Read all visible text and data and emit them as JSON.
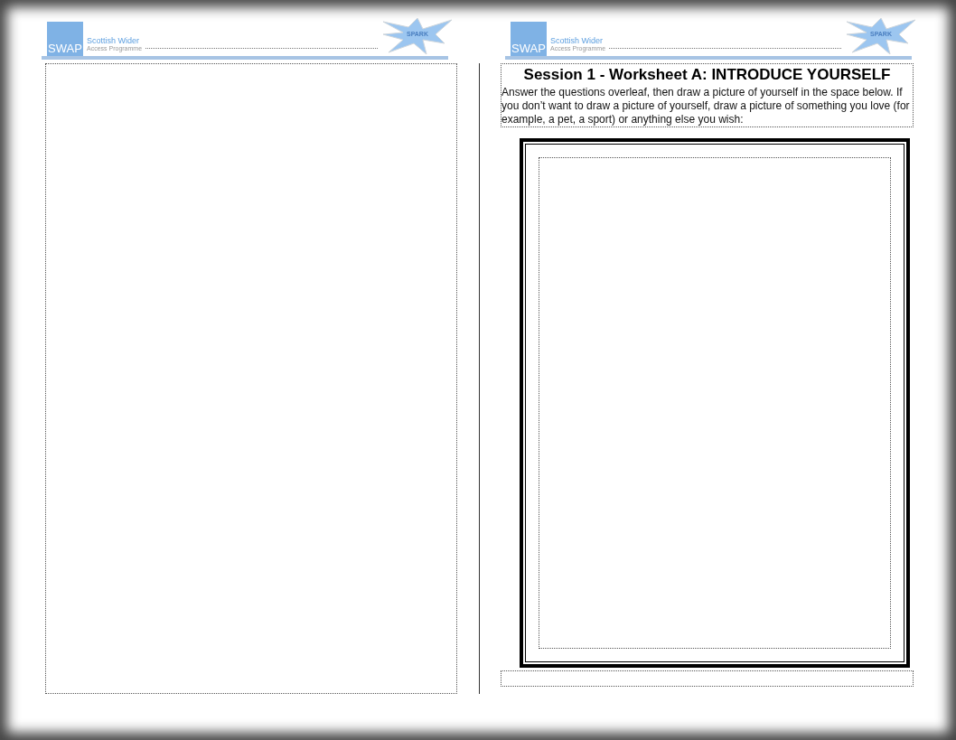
{
  "headers": [
    {
      "logo_text": "SWAP",
      "org_name": "Scottish Wider",
      "org_subtitle": "Access Programme",
      "badge": "SPARK"
    },
    {
      "logo_text": "SWAP",
      "org_name": "Scottish Wider",
      "org_subtitle": "Access Programme",
      "badge": "SPARK"
    }
  ],
  "worksheet": {
    "title": "Session 1 - Worksheet A: INTRODUCE YOURSELF",
    "instructions": "Answer the questions overleaf, then draw a picture of yourself in the space below. If you don’t want to draw a picture of yourself, draw a picture of something you love (for example, a pet, a sport) or anything else you wish:"
  }
}
